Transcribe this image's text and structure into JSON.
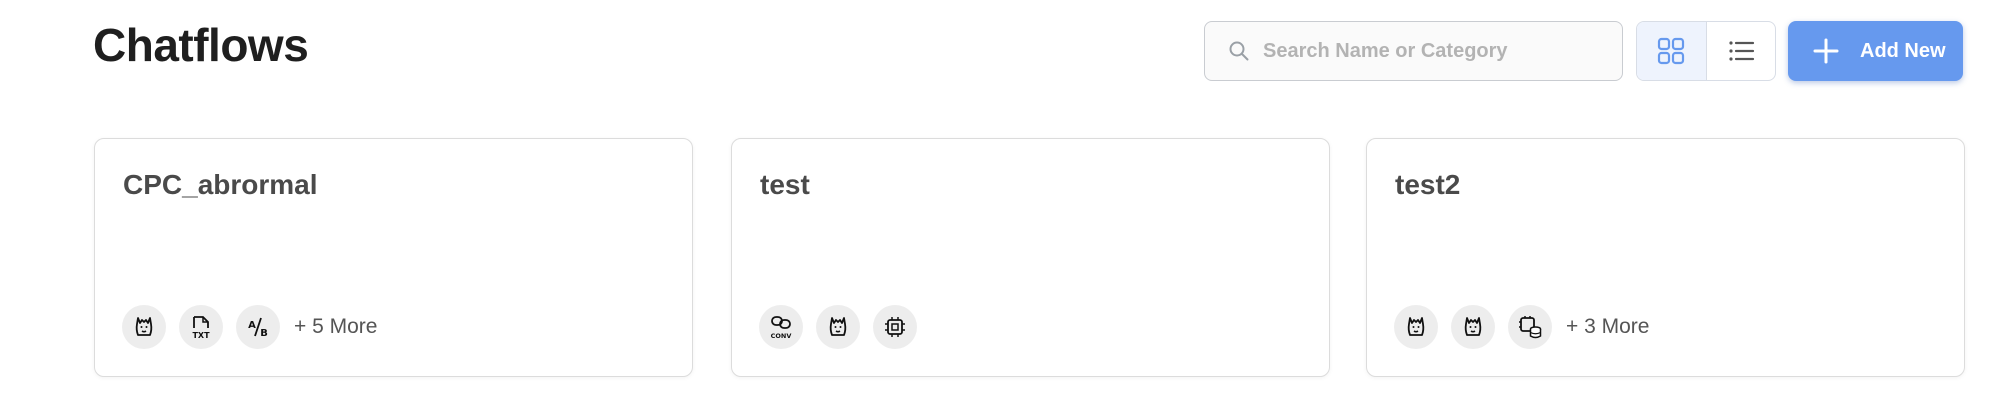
{
  "header": {
    "title": "Chatflows",
    "search_placeholder": "Search Name or Category",
    "search_value": "",
    "add_button_label": "Add New",
    "view_mode": "grid"
  },
  "colors": {
    "accent": "#6699ee",
    "toggle_active_bg": "#eef3fd",
    "icon_bg": "#ededed"
  },
  "cards": [
    {
      "title": "CPC_abrormal",
      "node_icons": [
        "llama-icon",
        "txt-file-icon",
        "ab-test-icon"
      ],
      "more_label": "+ 5 More"
    },
    {
      "title": "test",
      "node_icons": [
        "conversation-chain-icon",
        "llama-icon",
        "chip-icon"
      ],
      "more_label": ""
    },
    {
      "title": "test2",
      "node_icons": [
        "llama-icon",
        "llama-icon",
        "chip-database-icon"
      ],
      "more_label": "+ 3 More"
    }
  ]
}
